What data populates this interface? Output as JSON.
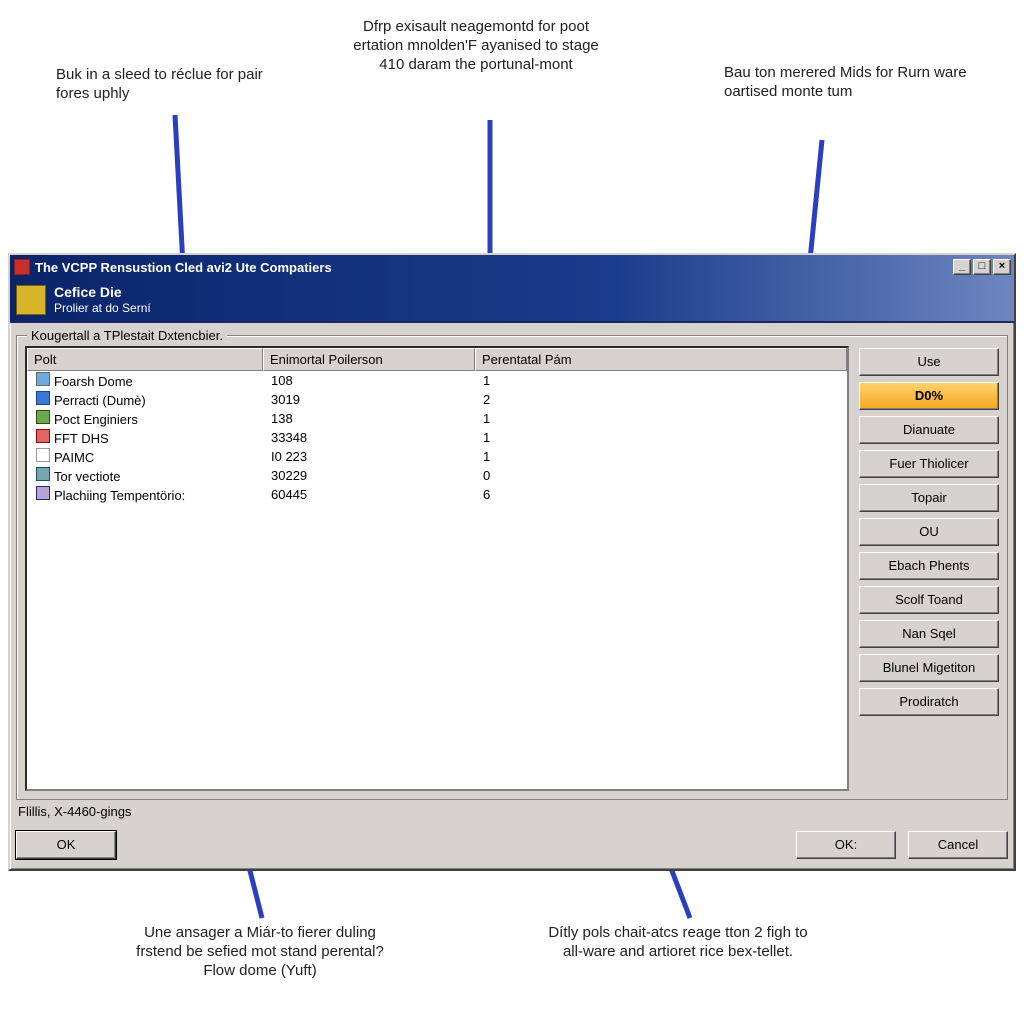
{
  "callouts": {
    "top_left": "Buk in a sleed to réclue for pair fores uphly",
    "top_mid": "Dfrp exisault neagemontd for poot ertation mnolden'F ayanised to stage 410 daram the portunal-mont",
    "top_right": "Bau ton merered Mids for Rurn ware oartised monte tum",
    "bottom_left": "Une ansager a Miár-to fierer duling frstend be sefied mot stand perental? Flow dome (Yuft)",
    "bottom_right": "Dítly pols chait-atcs reage tton 2 figh to all-ware and artioret rice bex-tellet."
  },
  "window": {
    "title": "The VCPP Rensustion Cled avi2 Ute Compatiers",
    "sub_line1": "Cefice Die",
    "sub_line2": "Prolier at do Serní"
  },
  "group_legend": "Kougertall a TPlestait Dxtencbier.",
  "columns": [
    "Polt",
    "Enimortal Poilerson",
    "Perentatal Pám"
  ],
  "rows": [
    {
      "icon": "i0",
      "c0": "Foarsh Dome",
      "c1": "108",
      "c2": "1"
    },
    {
      "icon": "i1",
      "c0": "Perracti (Dumè)",
      "c1": "3019",
      "c2": "2"
    },
    {
      "icon": "i2",
      "c0": "Poct Enginiers",
      "c1": "138",
      "c2": "1"
    },
    {
      "icon": "i3",
      "c0": "FFT DHS",
      "c1": "33348",
      "c2": "1"
    },
    {
      "icon": "i4",
      "c0": "PAIMC",
      "c1": "I0 223",
      "c2": "1"
    },
    {
      "icon": "i5",
      "c0": "Tor vectiote",
      "c1": "30229",
      "c2": "0"
    },
    {
      "icon": "i6",
      "c0": "Plachiing Tempentörio:",
      "c1": "60445",
      "c2": "6"
    }
  ],
  "selected_row": 6,
  "side_buttons": [
    "Use",
    "D0%",
    "Dianuate",
    "Fuer Thiolicer",
    "Topair",
    "OU",
    "Ebach Phents",
    "Scolf Toand",
    "Nan Sqel",
    "Blunel Migetiton",
    "Prodiratch"
  ],
  "accent_button_index": 1,
  "status_text": "Flillis, X-4460-gings",
  "dlg_ok": "OK",
  "dlg_ok2": "OK:",
  "dlg_cancel": "Cancel"
}
